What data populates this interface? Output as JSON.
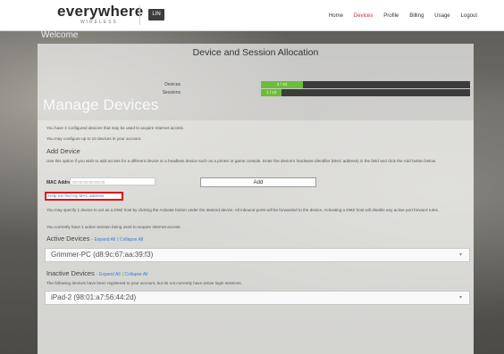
{
  "header": {
    "logo_word": "everywhere",
    "logo_sub": "WIRELESS",
    "badge": "LIN",
    "nav": [
      {
        "label": "Home",
        "active": false
      },
      {
        "label": "Devices",
        "active": true
      },
      {
        "label": "Profile",
        "active": false
      },
      {
        "label": "Billing",
        "active": false
      },
      {
        "label": "Usage",
        "active": false
      },
      {
        "label": "Logout",
        "active": false
      }
    ]
  },
  "welcome": "Welcome",
  "allocation": {
    "title": "Device and Session Allocation",
    "rows": [
      {
        "label": "Devices",
        "value_text": "2 / 10",
        "fraction": 0.2
      },
      {
        "label": "Sessions",
        "value_text": "1 / 10",
        "fraction": 0.1
      }
    ]
  },
  "manage": {
    "title": "Manage Devices",
    "configured_text": "You have 2 configured devices that may be used to acquire Internet access.",
    "configure_limit_text": "You may configure up to 10 devices in your account.",
    "add_device_heading": "Add Device",
    "add_device_help": "Use this option if you wish to add access for a different device or a headless device such as a printer or game console. Enter the device's hardware identifier (MAC address) in the field and click the Add button below.",
    "mac_label": "MAC Address:",
    "mac_placeholder": "00:00:00:00:00:00",
    "add_button": "Add",
    "help_link": "Help me find my MAC address",
    "dmz_text": "You may specify 1 device to act as a DMZ host by clicking the Activate button under the desired device. All inbound ports will be forwarded to the device. Activating a DMZ host will disable any active port forward rules.",
    "sessions_text": "You currently have 1 active session being used to acquire Internet access.",
    "active_heading": "Active Devices",
    "expand_all": "Expand All",
    "collapse_all": "Collapse All",
    "active_device": "Grimmer-PC (d8:9c:67:aa:39:f3)",
    "inactive_heading": "Inactive Devices",
    "inactive_text": "The following devices have been registered to your account, but do not currently have active login sessions.",
    "inactive_device": "iPad-2 (98:01:a7:56:44:2d)",
    "caret": "▾"
  },
  "colors": {
    "accent_red": "#d8262a",
    "bar_green": "#6bbd3a",
    "link_blue": "#3b7bd6",
    "highlight": "#e01010"
  }
}
